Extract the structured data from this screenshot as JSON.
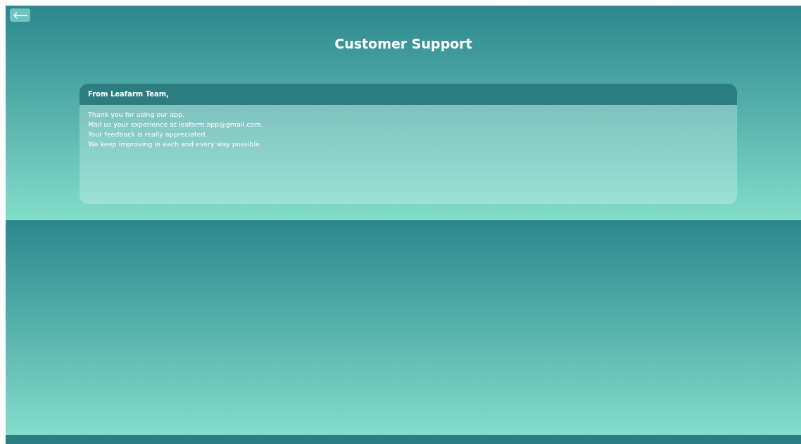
{
  "header": {
    "title": "Customer Support"
  },
  "card": {
    "heading": "From Leafarm Team,",
    "lines": [
      "Thank you for using our app.",
      "Mail us your experience at leafarm.app@gmail.com.",
      "Your feedback is really appreciated.",
      "We keep improving in each and every way possible."
    ]
  }
}
